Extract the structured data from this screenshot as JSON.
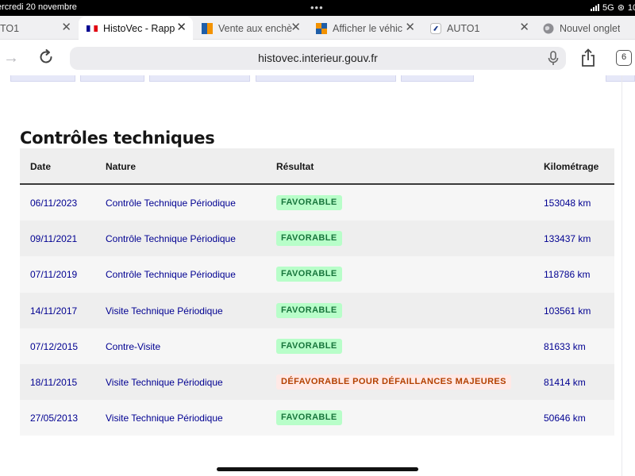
{
  "status_bar": {
    "time": "ercredi 20 novembre",
    "right": "5G",
    "battery": "10"
  },
  "tabs": [
    {
      "title": "TO1",
      "icon": "none",
      "active": false
    },
    {
      "title": "HistoVec - Rapp",
      "icon": "french-flag-icon",
      "active": true
    },
    {
      "title": "Vente aux enchè",
      "icon": "auction-site-icon",
      "active": false
    },
    {
      "title": "Afficher le véhic",
      "icon": "auction-site-icon",
      "active": false
    },
    {
      "title": "AUTO1",
      "icon": "auto1-icon",
      "active": false
    },
    {
      "title": "Nouvel onglet",
      "icon": "globe-icon",
      "active": false
    }
  ],
  "address_bar": {
    "url": "histovec.interieur.gouv.fr",
    "tab_count": "6"
  },
  "page": {
    "heading": "Contrôles techniques",
    "columns": {
      "date": "Date",
      "nature": "Nature",
      "result": "Résultat",
      "mileage": "Kilométrage"
    },
    "rows": [
      {
        "date": "06/11/2023",
        "nature": "Contrôle Technique Périodique",
        "result": "FAVORABLE",
        "status": "ok",
        "mileage": "153048 km"
      },
      {
        "date": "09/11/2021",
        "nature": "Contrôle Technique Périodique",
        "result": "FAVORABLE",
        "status": "ok",
        "mileage": "133437 km"
      },
      {
        "date": "07/11/2019",
        "nature": "Contrôle Technique Périodique",
        "result": "FAVORABLE",
        "status": "ok",
        "mileage": "118786 km"
      },
      {
        "date": "14/11/2017",
        "nature": "Visite Technique Périodique",
        "result": "FAVORABLE",
        "status": "ok",
        "mileage": "103561 km"
      },
      {
        "date": "07/12/2015",
        "nature": "Contre-Visite",
        "result": "FAVORABLE",
        "status": "ok",
        "mileage": "81633 km"
      },
      {
        "date": "18/11/2015",
        "nature": "Visite Technique Périodique",
        "result": "DÉFAVORABLE POUR DÉFAILLANCES MAJEURES",
        "status": "ko",
        "mileage": "81414 km"
      },
      {
        "date": "27/05/2013",
        "nature": "Visite Technique Périodique",
        "result": "FAVORABLE",
        "status": "ok",
        "mileage": "50646 km"
      }
    ]
  },
  "colors": {
    "link_blue": "#000091",
    "favorable_bg": "#b8fec9",
    "favorable_text": "#18753c",
    "unfavorable_bg": "#ffe9e6",
    "unfavorable_text": "#b34000"
  }
}
